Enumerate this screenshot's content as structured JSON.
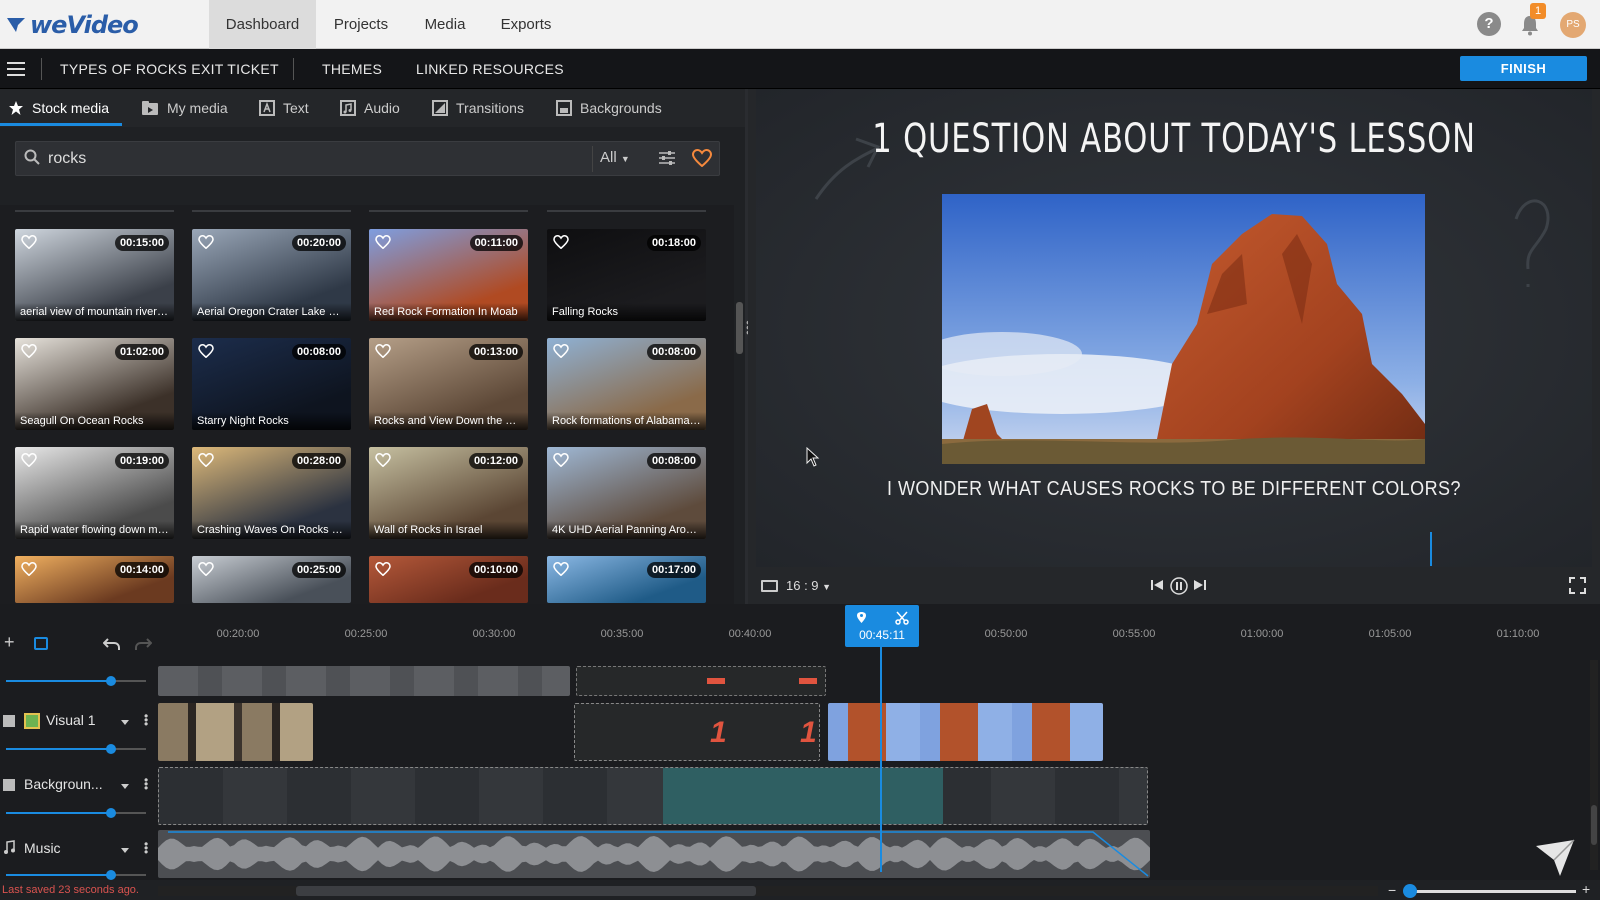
{
  "app": {
    "logo_text": "weVideo"
  },
  "nav": {
    "dashboard": "Dashboard",
    "projects": "Projects",
    "media": "Media",
    "exports": "Exports"
  },
  "header": {
    "help": "?",
    "notifications_count": "1",
    "avatar_initials": "PS"
  },
  "project": {
    "title": "TYPES OF ROCKS EXIT TICKET",
    "themes": "THEMES",
    "linked_resources": "LINKED RESOURCES",
    "finish": "FINISH"
  },
  "media_tabs": {
    "stock": "Stock media",
    "my_media": "My media",
    "text": "Text",
    "audio": "Audio",
    "transitions": "Transitions",
    "backgrounds": "Backgrounds"
  },
  "search": {
    "value": "rocks",
    "filter": "All"
  },
  "media_items": [
    {
      "duration": "00:15:00",
      "caption": "aerial view of mountain river n...",
      "c1": "#cfd6de",
      "c2": "#3b4049"
    },
    {
      "duration": "00:20:00",
      "caption": "Aerial Oregon Crater Lake Sno...",
      "c1": "#9aa7b8",
      "c2": "#2f3947"
    },
    {
      "duration": "00:11:00",
      "caption": "Red Rock Formation In Moab",
      "c1": "#7e9ee0",
      "c2": "#b04a22"
    },
    {
      "duration": "00:18:00",
      "caption": "Falling Rocks",
      "c1": "#0e0e10",
      "c2": "#1c1c1f"
    },
    {
      "duration": "01:02:00",
      "caption": "Seagull On Ocean Rocks",
      "c1": "#e6e2db",
      "c2": "#3c3129"
    },
    {
      "duration": "00:08:00",
      "caption": "Starry Night Rocks",
      "c1": "#1c2d4c",
      "c2": "#0e141f"
    },
    {
      "duration": "00:13:00",
      "caption": "Rocks and View Down the Mo...",
      "c1": "#b59f88",
      "c2": "#5d4837"
    },
    {
      "duration": "00:08:00",
      "caption": "Rock formations of Alabama H...",
      "c1": "#8fb1d4",
      "c2": "#8a6a49"
    },
    {
      "duration": "00:19:00",
      "caption": "Rapid water flowing down mo...",
      "c1": "#e8e8e8",
      "c2": "#4b4b4b"
    },
    {
      "duration": "00:28:00",
      "caption": "Crashing Waves On Rocks Dur...",
      "c1": "#ddb97a",
      "c2": "#2b3240"
    },
    {
      "duration": "00:12:00",
      "caption": "Wall of Rocks in Israel",
      "c1": "#c6c0a1",
      "c2": "#5b4634"
    },
    {
      "duration": "00:08:00",
      "caption": "4K UHD Aerial Panning Aroun...",
      "c1": "#9fb8d5",
      "c2": "#5e4b3c"
    },
    {
      "duration": "00:14:00",
      "caption": "",
      "c1": "#f0b060",
      "c2": "#6b3a20"
    },
    {
      "duration": "00:25:00",
      "caption": "",
      "c1": "#c8cdd3",
      "c2": "#495059"
    },
    {
      "duration": "00:10:00",
      "caption": "",
      "c1": "#b5593a",
      "c2": "#6a2c1c"
    },
    {
      "duration": "00:17:00",
      "caption": "",
      "c1": "#8bb8e4",
      "c2": "#1f5b87"
    }
  ],
  "preview": {
    "title": "1 QUESTION ABOUT TODAY'S LESSON",
    "caption": "I WONDER WHAT CAUSES ROCKS TO BE DIFFERENT COLORS?",
    "aspect": "16 : 9"
  },
  "timeline": {
    "playhead_time": "00:45:11",
    "ticks": [
      "00:20:00",
      "00:25:00",
      "00:30:00",
      "00:35:00",
      "00:40:00",
      "00:50:00",
      "00:55:00",
      "01:00:00",
      "01:05:00",
      "01:10:00"
    ],
    "tracks": [
      {
        "name": "Visual 1"
      },
      {
        "name": "Backgroun..."
      },
      {
        "name": "Music"
      }
    ],
    "save_status": "Last saved 23 seconds ago."
  }
}
